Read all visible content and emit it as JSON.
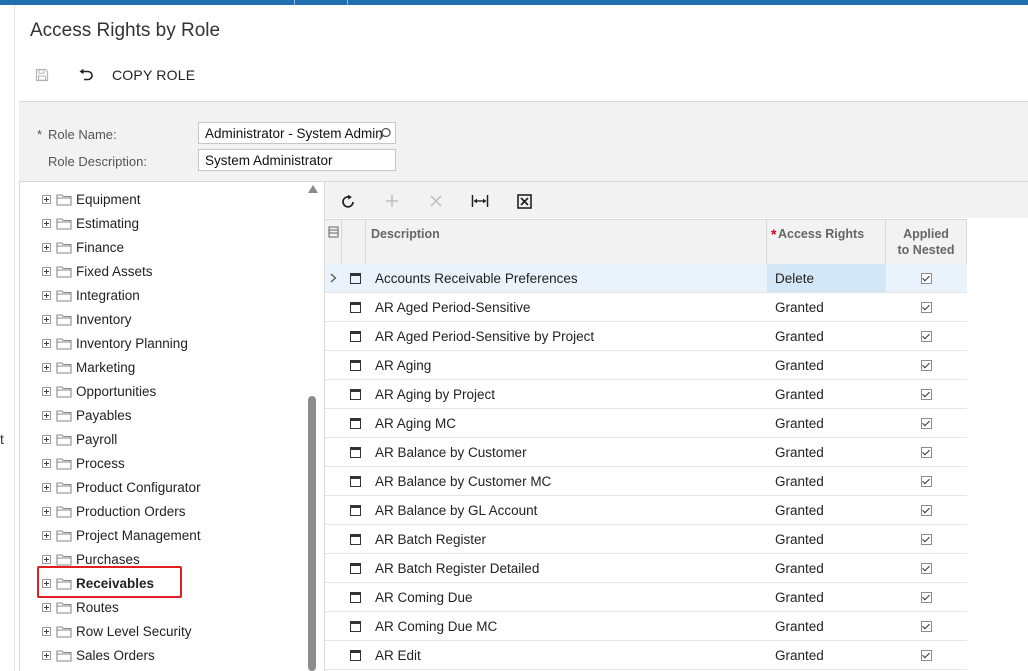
{
  "page": {
    "title": "Access Rights by Role"
  },
  "left_strip_text": "t",
  "toolbar": {
    "copy_label": "COPY ROLE"
  },
  "form": {
    "role_name_label": "Role Name:",
    "role_name_required": "*",
    "role_name_value": "Administrator - System Admin",
    "role_desc_label": "Role Description:",
    "role_desc_value": "System Administrator"
  },
  "tree": {
    "items": [
      {
        "label": "Equipment"
      },
      {
        "label": "Estimating"
      },
      {
        "label": "Finance"
      },
      {
        "label": "Fixed Assets"
      },
      {
        "label": "Integration"
      },
      {
        "label": "Inventory"
      },
      {
        "label": "Inventory Planning"
      },
      {
        "label": "Marketing"
      },
      {
        "label": "Opportunities"
      },
      {
        "label": "Payables"
      },
      {
        "label": "Payroll"
      },
      {
        "label": "Process"
      },
      {
        "label": "Product Configurator"
      },
      {
        "label": "Production Orders"
      },
      {
        "label": "Project Management"
      },
      {
        "label": "Purchases"
      },
      {
        "label": "Receivables"
      },
      {
        "label": "Routes"
      },
      {
        "label": "Row Level Security"
      },
      {
        "label": "Sales Orders"
      }
    ],
    "selected": "Receivables"
  },
  "grid": {
    "headers": {
      "description": "Description",
      "access_rights_star": "*",
      "access_rights": "Access Rights",
      "applied_line1": "Applied",
      "applied_line2": "to Nested"
    },
    "rows": [
      {
        "description": "Accounts Receivable Preferences",
        "rights": "Delete",
        "applied": true
      },
      {
        "description": "AR Aged Period-Sensitive",
        "rights": "Granted",
        "applied": true
      },
      {
        "description": "AR Aged Period-Sensitive by Project",
        "rights": "Granted",
        "applied": true
      },
      {
        "description": "AR Aging",
        "rights": "Granted",
        "applied": true
      },
      {
        "description": "AR Aging by Project",
        "rights": "Granted",
        "applied": true
      },
      {
        "description": "AR Aging MC",
        "rights": "Granted",
        "applied": true
      },
      {
        "description": "AR Balance by Customer",
        "rights": "Granted",
        "applied": true
      },
      {
        "description": "AR Balance by Customer MC",
        "rights": "Granted",
        "applied": true
      },
      {
        "description": "AR Balance by GL Account",
        "rights": "Granted",
        "applied": true
      },
      {
        "description": "AR Batch Register",
        "rights": "Granted",
        "applied": true
      },
      {
        "description": "AR Batch Register Detailed",
        "rights": "Granted",
        "applied": true
      },
      {
        "description": "AR Coming Due",
        "rights": "Granted",
        "applied": true
      },
      {
        "description": "AR Coming Due MC",
        "rights": "Granted",
        "applied": true
      },
      {
        "description": "AR Edit",
        "rights": "Granted",
        "applied": true
      }
    ]
  },
  "icons": {
    "save": "save-icon",
    "undo": "undo-icon",
    "lookup": "search-icon",
    "refresh": "refresh-icon",
    "add": "plus-icon",
    "delete": "close-icon",
    "fit": "fit-columns-icon",
    "export": "excel-export-icon"
  },
  "colors": {
    "accent": "#1f6fb2",
    "highlight": "#e02020",
    "selected_row": "#eaf3fb",
    "required": "#d0021b"
  }
}
